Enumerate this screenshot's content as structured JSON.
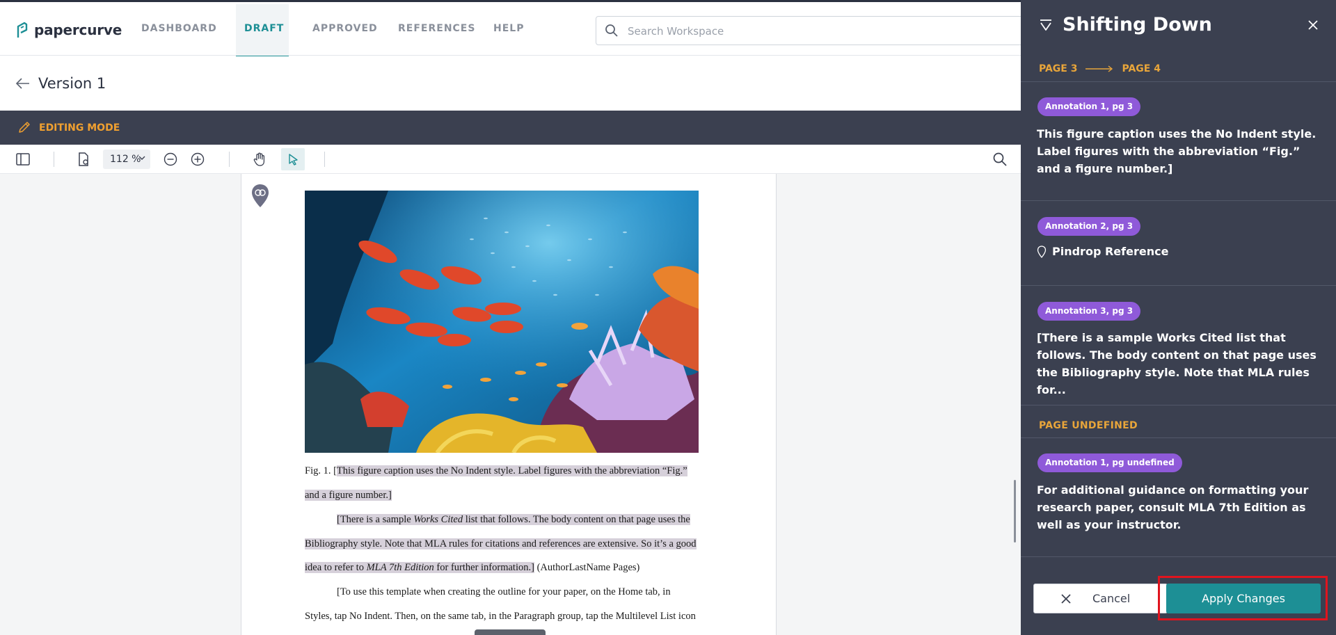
{
  "app": {
    "logo_text": "papercurve",
    "nav": [
      "DASHBOARD",
      "DRAFT",
      "APPROVED",
      "REFERENCES",
      "HELP"
    ],
    "active_nav": "DRAFT",
    "search_placeholder": "Search Workspace"
  },
  "version": {
    "title": "Version 1"
  },
  "editing": {
    "label": "EDITING MODE"
  },
  "toolbar": {
    "zoom": "112 %"
  },
  "document": {
    "caption_prefix": "Fig. 1. [",
    "caption_hl_line1": "This figure caption uses the No Indent style. Label figures with the abbreviation “Fig.”",
    "caption_hl_line2": "and a figure number.]",
    "para1_hl_a": "[There is a sample ",
    "para1_hl_italic": "Works Cited",
    "para1_hl_b": " list that follows. The body content on that page uses the",
    "para1_hl_line2": "Bibliography style. Note that MLA rules for citations and references are extensive. So it’s a good",
    "para1_hl_line3a": "idea to refer to ",
    "para1_hl_line3_italic": "MLA 7th Edition",
    "para1_hl_line3b": " for further information.]",
    "para1_tail": " (AuthorLastName Pages)",
    "para2_line1": "[To use this template when creating the outline for your paper, on the Home tab, in",
    "para2_line2": "Styles, tap No Indent. Then, on the same tab, in the Paragraph group, tap the Multilevel List icon"
  },
  "panel": {
    "title": "Shifting Down",
    "route_from": "PAGE 3",
    "route_to": "PAGE 4",
    "annotations": [
      {
        "badge": "Annotation 1, pg 3",
        "text": "This figure caption uses the No Indent style. Label figures with the abbreviation “Fig.” and a figure number.]"
      },
      {
        "badge": "Annotation 2, pg 3",
        "text": "Pindrop Reference"
      },
      {
        "badge": "Annotation 3, pg 3",
        "text": "[There is a sample Works Cited list that follows. The body content on that page uses the Bibliography style. Note that MLA rules for..."
      },
      {
        "badge": "Annotation 1, pg undefined",
        "text": "For additional guidance on formatting your research paper, consult MLA 7th Edition as well as your instructor."
      }
    ],
    "section_undefined": "PAGE UNDEFINED",
    "cancel_label": "Cancel",
    "apply_label": "Apply Changes"
  },
  "colors": {
    "accent_teal": "#1d8f95",
    "accent_orange": "#f0a030",
    "badge_purple": "#8f5ad9",
    "panel_bg": "#3b4050",
    "highlight_red": "#e0141e"
  }
}
